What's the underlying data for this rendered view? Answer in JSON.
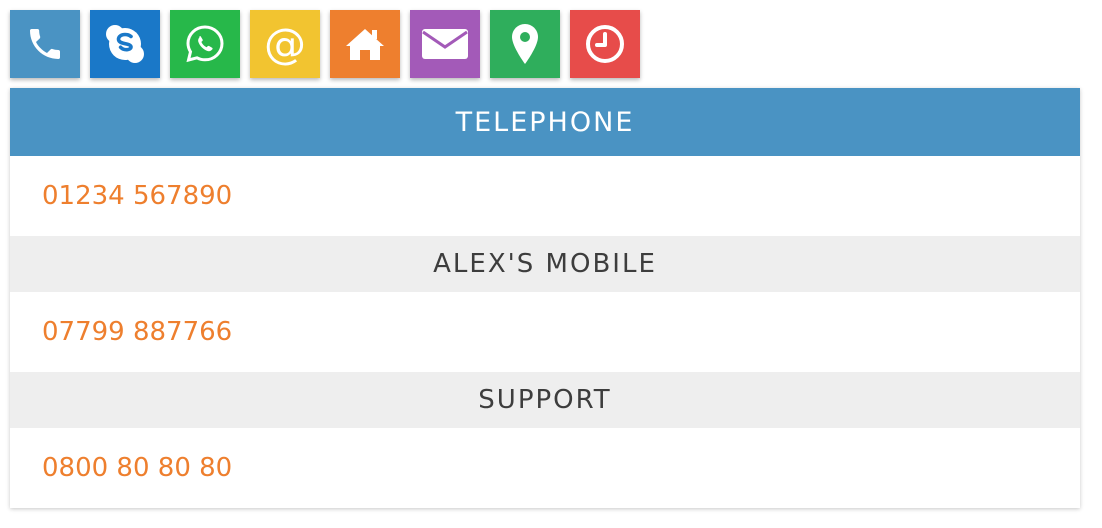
{
  "icons": [
    {
      "name": "phone-icon",
      "color": "#4a93c3"
    },
    {
      "name": "skype-icon",
      "color": "#1a78c8"
    },
    {
      "name": "whatsapp-icon",
      "color": "#27b84a"
    },
    {
      "name": "at-icon",
      "color": "#f2c430",
      "glyph": "@"
    },
    {
      "name": "home-icon",
      "color": "#ee7f2e"
    },
    {
      "name": "envelope-icon",
      "color": "#a35ab8"
    },
    {
      "name": "map-pin-icon",
      "color": "#2fae5c"
    },
    {
      "name": "clock-icon",
      "color": "#e74c4a"
    }
  ],
  "panel": {
    "title": "TELEPHONE",
    "entries": [
      {
        "label": "",
        "number": "01234 567890"
      },
      {
        "label": "ALEX'S MOBILE",
        "number": "07799 887766"
      },
      {
        "label": "SUPPORT",
        "number": "0800 80 80 80"
      }
    ]
  },
  "colors": {
    "header_bg": "#4a93c3",
    "section_bg": "#eeeeee",
    "number_text": "#ee7f2e",
    "section_text": "#3d3d3d"
  }
}
